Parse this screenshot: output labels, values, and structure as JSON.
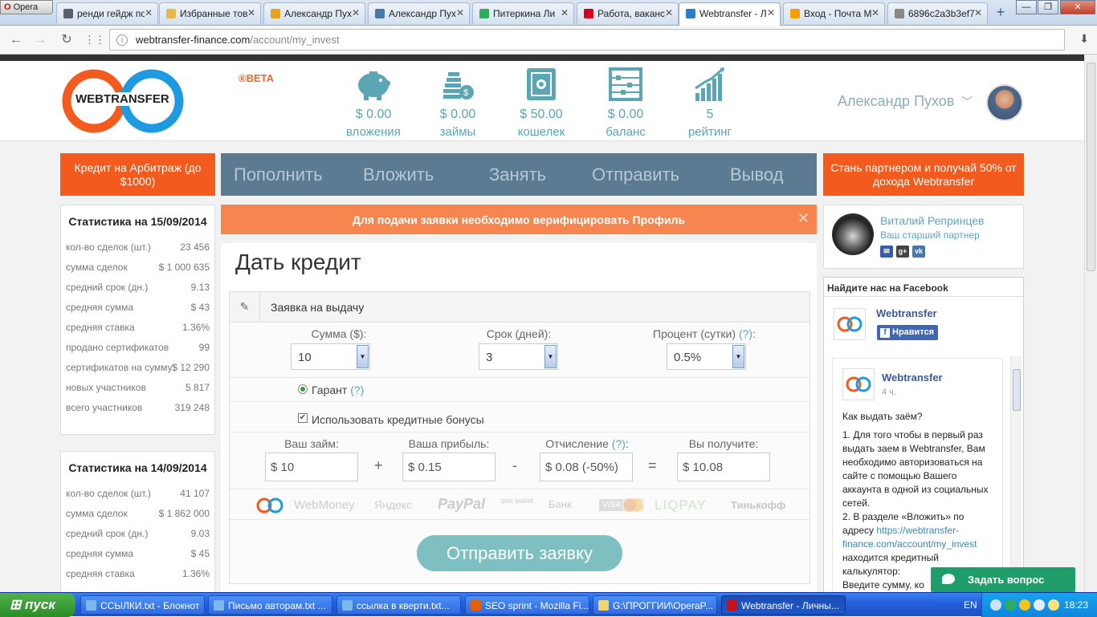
{
  "browser": {
    "opera_label": "Opera",
    "tabs": [
      {
        "title": "ренди гейдж по",
        "favicon_color": "#5a6070"
      },
      {
        "title": "Избранные тов",
        "favicon_color": "#e8b84a"
      },
      {
        "title": "Александр Пух",
        "favicon_color": "#e6a11f"
      },
      {
        "title": "Александр Пух",
        "favicon_color": "#4a76a8"
      },
      {
        "title": "Питеркина Ли",
        "favicon_color": "#2eab5b"
      },
      {
        "title": "Работа, ваканс",
        "favicon_color": "#d6001c"
      },
      {
        "title": "Webtransfer - Л",
        "favicon_color": "#2a7ec8"
      },
      {
        "title": "Вход - Почта М",
        "favicon_color": "#f2a100"
      },
      {
        "title": "6896c2a3b3ef7",
        "favicon_color": "#888888"
      }
    ],
    "new_tab": "+",
    "window_controls": {
      "minimize": "—",
      "maximize": "❐",
      "close": "✕"
    },
    "address": {
      "host": "webtransfer-finance.com",
      "path": "/account/my_invest"
    }
  },
  "header": {
    "logo_text": "WEBTRANSFER",
    "beta": "®BETA",
    "stats": [
      {
        "value": "$ 0.00",
        "label": "вложения",
        "icon": "piggy-bank-icon"
      },
      {
        "value": "$ 0.00",
        "label": "займы",
        "icon": "coins-icon"
      },
      {
        "value": "$ 50.00",
        "label": "кошелек",
        "icon": "safe-icon"
      },
      {
        "value": "$ 0.00",
        "label": "баланс",
        "icon": "abacus-icon"
      },
      {
        "value": "5",
        "label": "рейтинг",
        "icon": "growth-chart-icon"
      }
    ],
    "user_name": "Александр Пухов",
    "user_chevron": "﹀"
  },
  "promo_left": "Кредит на Арбитраж (до $1000)",
  "promo_right": "Стань партнером и получай 50% от дохода Webtransfer",
  "menu": [
    "Пополнить",
    "Вложить",
    "Занять",
    "Отправить",
    "Вывод"
  ],
  "stats_blocks": [
    {
      "title": "Статистика на 15/09/2014",
      "rows": [
        {
          "label": "кол-во сделок (шт.)",
          "value": "23 456"
        },
        {
          "label": "сумма сделок",
          "value": "$ 1 000 635"
        },
        {
          "label": "средний срок (дн.)",
          "value": "9.13"
        },
        {
          "label": "средняя сумма",
          "value": "$ 43"
        },
        {
          "label": "средняя ставка",
          "value": "1.36%"
        },
        {
          "label": "продано сертификатов",
          "value": "99"
        },
        {
          "label": "сертификатов на сумму",
          "value": "$ 12 290"
        },
        {
          "label": "новых участников",
          "value": "5 817"
        },
        {
          "label": "всего участников",
          "value": "319 248"
        }
      ]
    },
    {
      "title": "Статистика на 14/09/2014",
      "rows": [
        {
          "label": "кол-во сделок (шт.)",
          "value": "41 107"
        },
        {
          "label": "сумма сделок",
          "value": "$ 1 862 000"
        },
        {
          "label": "средний срок (дн.)",
          "value": "9.03"
        },
        {
          "label": "средняя сумма",
          "value": "$ 45"
        },
        {
          "label": "средняя ставка",
          "value": "1.36%"
        }
      ]
    }
  ],
  "alert": {
    "text": "Для подачи заявки необходимо верифицировать Профиль",
    "close": "✕"
  },
  "credit_form": {
    "page_title": "Дать кредит",
    "panel_title": "Заявка на выдачу",
    "amount": {
      "label": "Сумма ($):",
      "value": "10"
    },
    "term": {
      "label": "Срок (дней):",
      "value": "3"
    },
    "percent": {
      "label": "Процент (сутки)",
      "help": "(?)",
      "suffix": ":",
      "value": "0.5%"
    },
    "guarantee": {
      "label": "Гарант",
      "help": "(?)",
      "checked": true
    },
    "use_bonus": {
      "label": "Использовать кредитные бонусы",
      "checked": true
    },
    "your_loan": {
      "label": "Ваш займ:",
      "value": "$ 10"
    },
    "your_profit": {
      "label": "Ваша прибыль:",
      "value": "$ 0.15"
    },
    "deduction": {
      "label": "Отчисление",
      "help": "(?)",
      "suffix": ":",
      "value": "$ 0.08 (-50%)"
    },
    "you_get": {
      "label": "Вы получите:",
      "value": "$ 10.08"
    },
    "operators": {
      "plus": "+",
      "minus": "-",
      "equals": "="
    },
    "payment_methods": [
      "WebMoney",
      "Яндекс",
      "PayPal",
      "qiwi wallet",
      "Банк",
      "VISA",
      "LIQPAY",
      "Тинькофф"
    ],
    "submit": "Отправить заявку"
  },
  "partner": {
    "name": "Виталий Репринцев",
    "role": "Ваш старший партнер",
    "social": [
      "✉",
      "g+",
      "vk"
    ]
  },
  "facebook": {
    "header": "Найдите нас на Facebook",
    "page_name": "Webtransfer",
    "like": "Нравится",
    "like_f": "f",
    "post_name": "Webtransfer",
    "post_time": "4 ч.",
    "post_q": "Как выдать заём?",
    "post_p1": "1. Для того чтобы в первый раз выдать заем в Webtransfer, Вам необходимо авторизоваться на сайте с помощью Вашего аккаунта в одной из социальных сетей.",
    "post_p2a": "2. В разделе «Вложить» по адресу",
    "post_link": "https://webtransfer-finance.com/account/my_invest",
    "post_p2b": "находится кредитный калькулятор:",
    "post_p3": "Введите сумму, ко"
  },
  "chat_button": "Задать вопрос",
  "taskbar": {
    "start": "пуск",
    "tasks": [
      {
        "title": "ССЫЛКИ.txt - Блокнот",
        "icon_color": "#7bb8f0"
      },
      {
        "title": "Письмо авторам.txt ...",
        "icon_color": "#7bb8f0"
      },
      {
        "title": "ссылка в кверти.txt...",
        "icon_color": "#7bb8f0"
      },
      {
        "title": "SEO sprint - Mozilla Fi...",
        "icon_color": "#e66000"
      },
      {
        "title": "G:\\ПРОГГИИ\\OperaP...",
        "icon_color": "#f5d36b"
      },
      {
        "title": "Webtransfer - Личны...",
        "icon_color": "#cc0f16"
      }
    ],
    "lang": "EN",
    "clock": "18:23"
  }
}
